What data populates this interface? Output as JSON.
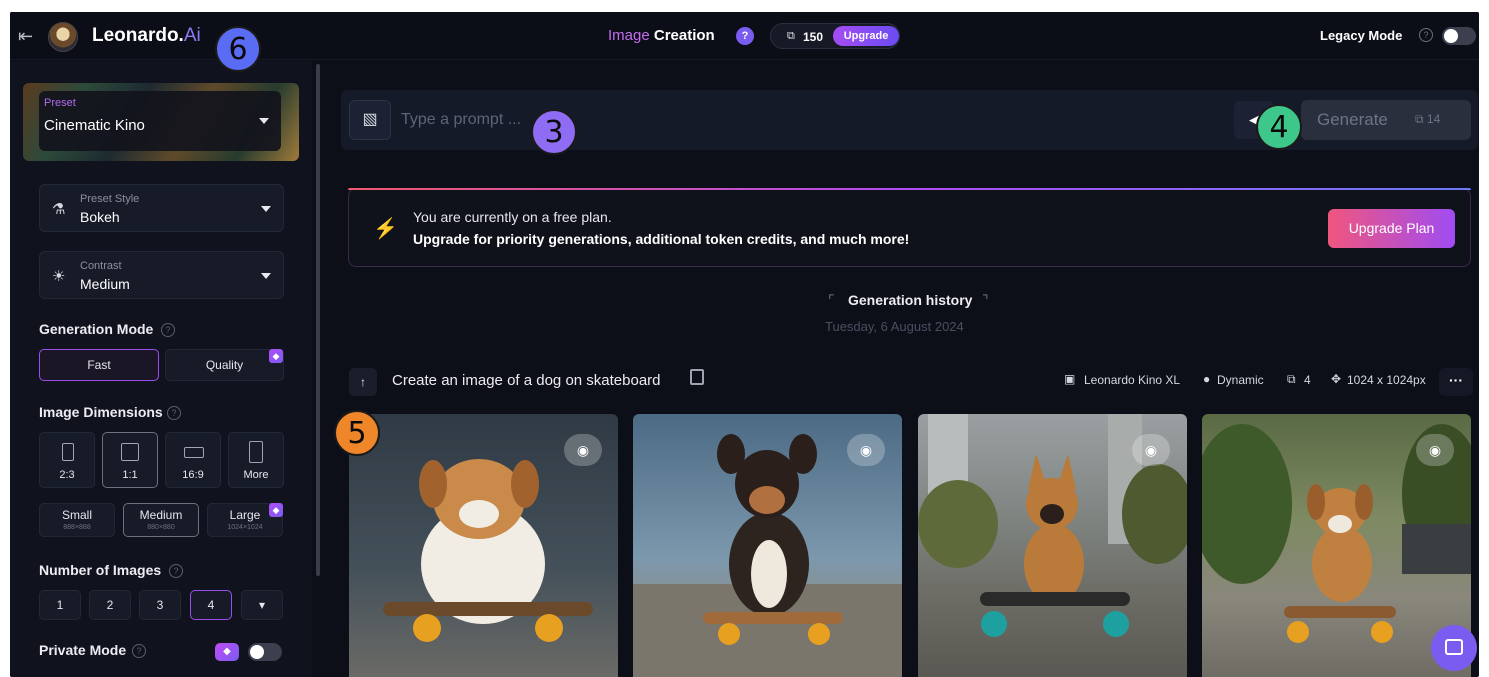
{
  "topbar": {
    "back_icon": "arrow-left-icon",
    "brand_name": "Leonardo.",
    "brand_suffix": "Ai",
    "title_accent": "Image",
    "title_main": "Creation",
    "help_label": "?",
    "token_icon": "token-icon",
    "token_glyph": "⧉",
    "token_count": "150",
    "upgrade_label": "Upgrade",
    "legacy_label": "Legacy Mode",
    "legacy_help": "?"
  },
  "sidebar": {
    "preset": {
      "label": "Preset",
      "value": "Cinematic Kino"
    },
    "preset_style": {
      "label": "Preset Style",
      "value": "Bokeh",
      "icon": "flask-icon",
      "glyph": "⚗"
    },
    "contrast": {
      "label": "Contrast",
      "value": "Medium",
      "icon": "sun-icon",
      "glyph": "☀"
    },
    "generation_mode": {
      "title": "Generation Mode",
      "help": "?",
      "options": [
        "Fast",
        "Quality"
      ],
      "selected": "Fast"
    },
    "image_dimensions": {
      "title": "Image Dimensions",
      "help": "?",
      "ratios": [
        "2:3",
        "1:1",
        "16:9",
        "More"
      ],
      "selected_ratio": "1:1",
      "sizes": [
        {
          "label": "Small",
          "sub": "888×888"
        },
        {
          "label": "Medium",
          "sub": "880×880"
        },
        {
          "label": "Large",
          "sub": "1024×1024"
        }
      ],
      "selected_size": "Medium"
    },
    "number_of_images": {
      "title": "Number of Images",
      "help": "?",
      "options": [
        "1",
        "2",
        "3",
        "4"
      ],
      "selected": "4",
      "more_glyph": "▾"
    },
    "private_mode": {
      "label": "Private Mode",
      "help": "?"
    }
  },
  "prompt": {
    "image_icon": "image-sparkle-icon",
    "image_glyph": "▧",
    "placeholder": "Type a prompt ...",
    "tool_glyph": "◀",
    "generate_label": "Generate",
    "generate_cost": "⧉ 14"
  },
  "banner": {
    "icon": "bolt-icon",
    "glyph": "⚡",
    "line1": "You are currently on a free plan.",
    "line2": "Upgrade for priority generations, additional token credits, and much more!",
    "button_label": "Upgrade Plan"
  },
  "history": {
    "title": "Generation history",
    "left_bracket": "⌜",
    "right_bracket": "⌝",
    "date": "Tuesday, 6 August 2024"
  },
  "generation": {
    "pin_glyph": "↑",
    "prompt_text": "Create an image of a dog on skateboard",
    "model": "Leonardo Kino XL",
    "style": "Dynamic",
    "count": "4",
    "size": "1024 x 1024px",
    "more_label": "···",
    "eye_glyph": "◉",
    "images": [
      {
        "alt": "dog-on-skateboard-1",
        "bg": "#3a4550",
        "dog": "#c98a4a"
      },
      {
        "alt": "dog-on-skateboard-2",
        "bg": "#6e8ea0",
        "dog": "#3a2a20"
      },
      {
        "alt": "dog-on-skateboard-3",
        "bg": "#8a8a82",
        "dog": "#b97a3a"
      },
      {
        "alt": "dog-on-skateboard-4",
        "bg": "#6a7a52",
        "dog": "#c08040"
      }
    ]
  },
  "annotations": [
    {
      "label": "6",
      "color": "#5a6cf3"
    },
    {
      "label": "3",
      "color": "#8e6cf3"
    },
    {
      "label": "4",
      "color": "#3ec78a"
    },
    {
      "label": "5",
      "color": "#f0862a"
    }
  ],
  "colors": {
    "accent_purple": "#9a4ef0",
    "background": "#0c0f17",
    "upgrade_gradient_start": "#f0567e",
    "upgrade_gradient_end": "#a04cf3"
  }
}
